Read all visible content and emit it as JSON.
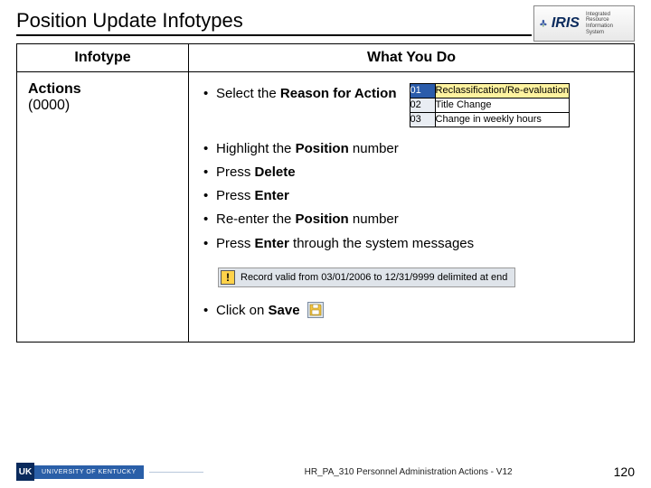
{
  "title": "Position Update Infotypes",
  "logo": {
    "brand": "IRIS",
    "subtitle": "Integrated Resource Information System"
  },
  "table": {
    "headers": {
      "left": "Infotype",
      "right": "What You Do"
    },
    "infotype": {
      "name": "Actions",
      "code": "(0000)"
    },
    "steps": {
      "s1a": "Select the ",
      "s1b": "Reason for Action",
      "s2a": "Highlight the ",
      "s2b": "Position",
      "s2c": " number",
      "s3a": "Press ",
      "s3b": "Delete",
      "s4a": "Press ",
      "s4b": "Enter",
      "s5a": "Re-enter the ",
      "s5b": "Position",
      "s5c": " number",
      "s6a": "Press ",
      "s6b": "Enter",
      "s6c": " through the system messages",
      "s7a": "Click on ",
      "s7b": "Save"
    },
    "reasons": [
      {
        "code": "01",
        "label": "Reclassification/Re-evaluation",
        "selected": true
      },
      {
        "code": "02",
        "label": "Title Change",
        "selected": false
      },
      {
        "code": "03",
        "label": "Change in weekly hours",
        "selected": false
      }
    ],
    "warning": "Record valid from 03/01/2006 to 12/31/9999 delimited at end"
  },
  "footer": {
    "org_short": "UK",
    "org_long": "UNIVERSITY OF KENTUCKY",
    "doc": "HR_PA_310 Personnel Administration Actions - V12",
    "page": "120"
  }
}
